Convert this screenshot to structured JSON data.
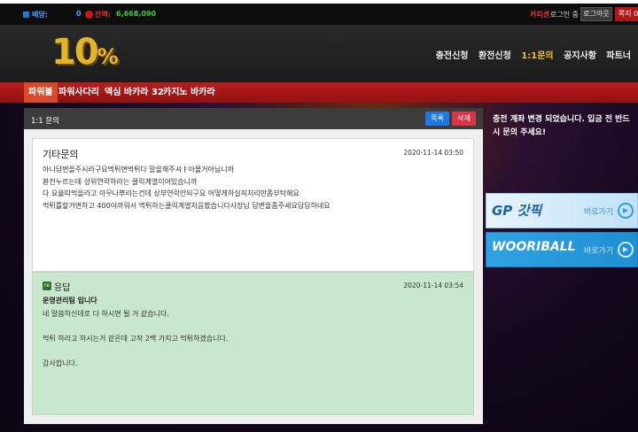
{
  "topbar": {
    "bet_label": "배당:",
    "bet_value": "0",
    "cash_label": "잔액:",
    "cash_value": "6,668,090",
    "user_name": "카피센",
    "login_status": "로그인 중",
    "logout_label": "로그아웃",
    "message_label": "쪽지 0"
  },
  "header": {
    "logo_main": "10",
    "logo_pct": "%",
    "nav": [
      "충전신청",
      "환전신청",
      "1:1문의",
      "공지사항",
      "파트너"
    ],
    "nav_active_index": 2
  },
  "subnav": {
    "items": [
      "파워볼",
      "파워사다리",
      "엑심 바카라 32",
      "카지노 바카라"
    ],
    "active_index": 0
  },
  "panel": {
    "title": "1:1 문의",
    "list_button": "목록",
    "delete_button": "삭제",
    "question": {
      "title": "기타문의",
      "date": "2020-11-14 03:50",
      "lines": [
        "아니답변을주시라구요먹튀면먹튀다 말을해주셔ㅑ아몰거아닙니까",
        "환전누르는데 상위연락하라는 클릭계열이어있습니까",
        "다 요율따먹을라고 아무나뿌리는건데 상부연락안되구요 어떻게하실지처리만좀부탁해요",
        "먹튀를할거면하고 400아까워서 먹튀하는클릭계열처음봤습니다사장님 답변을좀주세요답답하네요"
      ]
    },
    "answer": {
      "icon_text": "re",
      "title": "응답",
      "date": "2020-11-14 03:54",
      "team": "운영관리팀 입니다",
      "line1": "네 말씀하신데로 다 하시면 될 거 같습니다.",
      "line2": "먹튀 하라고 하시는거 같은데 고작 2백 가지고 먹튀하겠습니다.",
      "line3": "감사합니다."
    }
  },
  "sidebar": {
    "notice": "충전 계좌 변경 되었습니다. 입금 전 반드시 문의 주세요!",
    "banners": [
      {
        "logo": "GP 갓픽",
        "go": "바로가기"
      },
      {
        "logo": "WOORIBALL",
        "go": "바로가기"
      }
    ]
  }
}
